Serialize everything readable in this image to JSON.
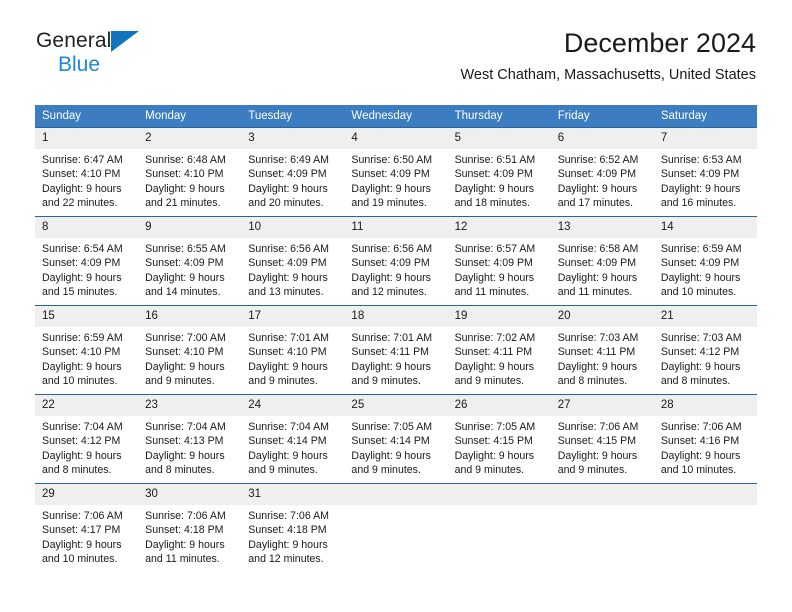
{
  "logo": {
    "word1": "General",
    "word2": "Blue",
    "triangle_color": "#1274bc",
    "word2_color": "#1b87dc"
  },
  "header": {
    "title": "December 2024",
    "location": "West Chatham, Massachusetts, United States",
    "header_bg": "#3b7dc0",
    "row_border": "#28659f",
    "daynum_bg": "#efefef"
  },
  "weekdays": [
    "Sunday",
    "Monday",
    "Tuesday",
    "Wednesday",
    "Thursday",
    "Friday",
    "Saturday"
  ],
  "weeks": [
    [
      {
        "day": "1",
        "sunrise": "Sunrise: 6:47 AM",
        "sunset": "Sunset: 4:10 PM",
        "daylight1": "Daylight: 9 hours",
        "daylight2": "and 22 minutes."
      },
      {
        "day": "2",
        "sunrise": "Sunrise: 6:48 AM",
        "sunset": "Sunset: 4:10 PM",
        "daylight1": "Daylight: 9 hours",
        "daylight2": "and 21 minutes."
      },
      {
        "day": "3",
        "sunrise": "Sunrise: 6:49 AM",
        "sunset": "Sunset: 4:09 PM",
        "daylight1": "Daylight: 9 hours",
        "daylight2": "and 20 minutes."
      },
      {
        "day": "4",
        "sunrise": "Sunrise: 6:50 AM",
        "sunset": "Sunset: 4:09 PM",
        "daylight1": "Daylight: 9 hours",
        "daylight2": "and 19 minutes."
      },
      {
        "day": "5",
        "sunrise": "Sunrise: 6:51 AM",
        "sunset": "Sunset: 4:09 PM",
        "daylight1": "Daylight: 9 hours",
        "daylight2": "and 18 minutes."
      },
      {
        "day": "6",
        "sunrise": "Sunrise: 6:52 AM",
        "sunset": "Sunset: 4:09 PM",
        "daylight1": "Daylight: 9 hours",
        "daylight2": "and 17 minutes."
      },
      {
        "day": "7",
        "sunrise": "Sunrise: 6:53 AM",
        "sunset": "Sunset: 4:09 PM",
        "daylight1": "Daylight: 9 hours",
        "daylight2": "and 16 minutes."
      }
    ],
    [
      {
        "day": "8",
        "sunrise": "Sunrise: 6:54 AM",
        "sunset": "Sunset: 4:09 PM",
        "daylight1": "Daylight: 9 hours",
        "daylight2": "and 15 minutes."
      },
      {
        "day": "9",
        "sunrise": "Sunrise: 6:55 AM",
        "sunset": "Sunset: 4:09 PM",
        "daylight1": "Daylight: 9 hours",
        "daylight2": "and 14 minutes."
      },
      {
        "day": "10",
        "sunrise": "Sunrise: 6:56 AM",
        "sunset": "Sunset: 4:09 PM",
        "daylight1": "Daylight: 9 hours",
        "daylight2": "and 13 minutes."
      },
      {
        "day": "11",
        "sunrise": "Sunrise: 6:56 AM",
        "sunset": "Sunset: 4:09 PM",
        "daylight1": "Daylight: 9 hours",
        "daylight2": "and 12 minutes."
      },
      {
        "day": "12",
        "sunrise": "Sunrise: 6:57 AM",
        "sunset": "Sunset: 4:09 PM",
        "daylight1": "Daylight: 9 hours",
        "daylight2": "and 11 minutes."
      },
      {
        "day": "13",
        "sunrise": "Sunrise: 6:58 AM",
        "sunset": "Sunset: 4:09 PM",
        "daylight1": "Daylight: 9 hours",
        "daylight2": "and 11 minutes."
      },
      {
        "day": "14",
        "sunrise": "Sunrise: 6:59 AM",
        "sunset": "Sunset: 4:09 PM",
        "daylight1": "Daylight: 9 hours",
        "daylight2": "and 10 minutes."
      }
    ],
    [
      {
        "day": "15",
        "sunrise": "Sunrise: 6:59 AM",
        "sunset": "Sunset: 4:10 PM",
        "daylight1": "Daylight: 9 hours",
        "daylight2": "and 10 minutes."
      },
      {
        "day": "16",
        "sunrise": "Sunrise: 7:00 AM",
        "sunset": "Sunset: 4:10 PM",
        "daylight1": "Daylight: 9 hours",
        "daylight2": "and 9 minutes."
      },
      {
        "day": "17",
        "sunrise": "Sunrise: 7:01 AM",
        "sunset": "Sunset: 4:10 PM",
        "daylight1": "Daylight: 9 hours",
        "daylight2": "and 9 minutes."
      },
      {
        "day": "18",
        "sunrise": "Sunrise: 7:01 AM",
        "sunset": "Sunset: 4:11 PM",
        "daylight1": "Daylight: 9 hours",
        "daylight2": "and 9 minutes."
      },
      {
        "day": "19",
        "sunrise": "Sunrise: 7:02 AM",
        "sunset": "Sunset: 4:11 PM",
        "daylight1": "Daylight: 9 hours",
        "daylight2": "and 9 minutes."
      },
      {
        "day": "20",
        "sunrise": "Sunrise: 7:03 AM",
        "sunset": "Sunset: 4:11 PM",
        "daylight1": "Daylight: 9 hours",
        "daylight2": "and 8 minutes."
      },
      {
        "day": "21",
        "sunrise": "Sunrise: 7:03 AM",
        "sunset": "Sunset: 4:12 PM",
        "daylight1": "Daylight: 9 hours",
        "daylight2": "and 8 minutes."
      }
    ],
    [
      {
        "day": "22",
        "sunrise": "Sunrise: 7:04 AM",
        "sunset": "Sunset: 4:12 PM",
        "daylight1": "Daylight: 9 hours",
        "daylight2": "and 8 minutes."
      },
      {
        "day": "23",
        "sunrise": "Sunrise: 7:04 AM",
        "sunset": "Sunset: 4:13 PM",
        "daylight1": "Daylight: 9 hours",
        "daylight2": "and 8 minutes."
      },
      {
        "day": "24",
        "sunrise": "Sunrise: 7:04 AM",
        "sunset": "Sunset: 4:14 PM",
        "daylight1": "Daylight: 9 hours",
        "daylight2": "and 9 minutes."
      },
      {
        "day": "25",
        "sunrise": "Sunrise: 7:05 AM",
        "sunset": "Sunset: 4:14 PM",
        "daylight1": "Daylight: 9 hours",
        "daylight2": "and 9 minutes."
      },
      {
        "day": "26",
        "sunrise": "Sunrise: 7:05 AM",
        "sunset": "Sunset: 4:15 PM",
        "daylight1": "Daylight: 9 hours",
        "daylight2": "and 9 minutes."
      },
      {
        "day": "27",
        "sunrise": "Sunrise: 7:06 AM",
        "sunset": "Sunset: 4:15 PM",
        "daylight1": "Daylight: 9 hours",
        "daylight2": "and 9 minutes."
      },
      {
        "day": "28",
        "sunrise": "Sunrise: 7:06 AM",
        "sunset": "Sunset: 4:16 PM",
        "daylight1": "Daylight: 9 hours",
        "daylight2": "and 10 minutes."
      }
    ],
    [
      {
        "day": "29",
        "sunrise": "Sunrise: 7:06 AM",
        "sunset": "Sunset: 4:17 PM",
        "daylight1": "Daylight: 9 hours",
        "daylight2": "and 10 minutes."
      },
      {
        "day": "30",
        "sunrise": "Sunrise: 7:06 AM",
        "sunset": "Sunset: 4:18 PM",
        "daylight1": "Daylight: 9 hours",
        "daylight2": "and 11 minutes."
      },
      {
        "day": "31",
        "sunrise": "Sunrise: 7:06 AM",
        "sunset": "Sunset: 4:18 PM",
        "daylight1": "Daylight: 9 hours",
        "daylight2": "and 12 minutes."
      },
      {
        "day": "",
        "sunrise": "",
        "sunset": "",
        "daylight1": "",
        "daylight2": ""
      },
      {
        "day": "",
        "sunrise": "",
        "sunset": "",
        "daylight1": "",
        "daylight2": ""
      },
      {
        "day": "",
        "sunrise": "",
        "sunset": "",
        "daylight1": "",
        "daylight2": ""
      },
      {
        "day": "",
        "sunrise": "",
        "sunset": "",
        "daylight1": "",
        "daylight2": ""
      }
    ]
  ]
}
